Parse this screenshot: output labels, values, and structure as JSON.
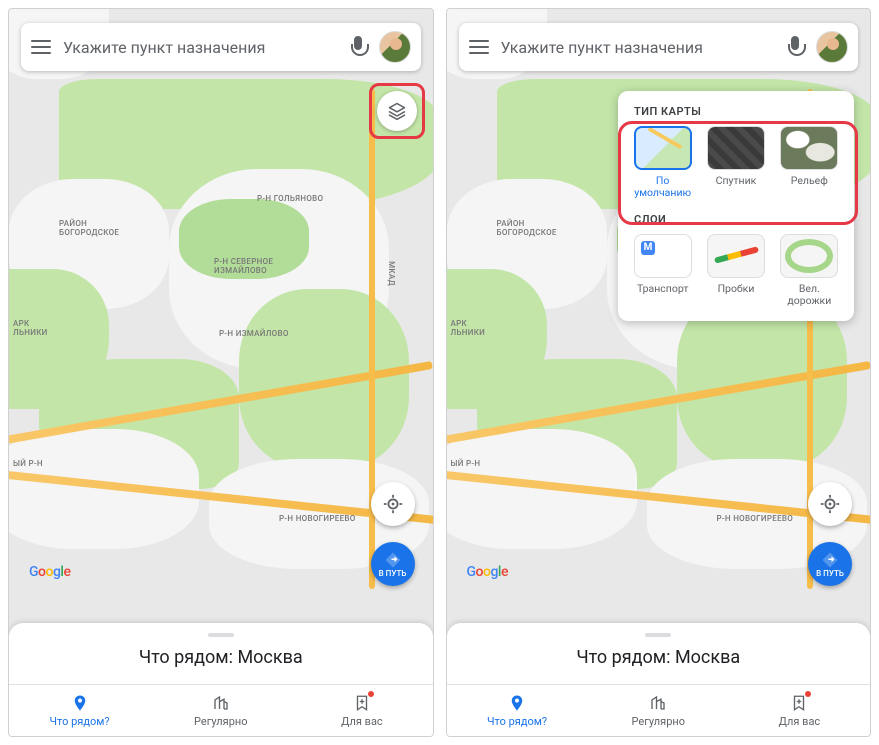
{
  "search": {
    "placeholder": "Укажите пункт назначения"
  },
  "map": {
    "labels": {
      "bogorodskoe": "РАЙОН\nБОГОРОДСКОЕ",
      "golyanovo": "Р-Н ГОЛЬЯНОВО",
      "sev_izmaylovo": "Р-Н СЕВЕРНОЕ\nИЗМАЙЛОВО",
      "izmaylovo": "Р-Н ИЗМАЙЛОВО",
      "novogireevo": "Р-Н НОВОГИРЕЕВО",
      "park": "АРК\nЛЬНИКИ",
      "rayon": "ЫЙ Р-Н",
      "mkad": "МКАД"
    }
  },
  "layersPanel": {
    "mapTypeTitle": "ТИП КАРТЫ",
    "layersTitle": "СЛОИ",
    "types": {
      "default": "По\nумолчанию",
      "satellite": "Спутник",
      "terrain": "Рельеф"
    },
    "layers": {
      "transit": "Транспорт",
      "traffic": "Пробки",
      "bike": "Вел.\nдорожки"
    }
  },
  "goFab": {
    "label": "В ПУТЬ"
  },
  "googleLogo": [
    "G",
    "o",
    "o",
    "g",
    "l",
    "e"
  ],
  "bottomSheet": {
    "title": "Что рядом: Москва"
  },
  "bottomNav": {
    "explore": "Что рядом?",
    "commute": "Регулярно",
    "foryou": "Для вас"
  }
}
